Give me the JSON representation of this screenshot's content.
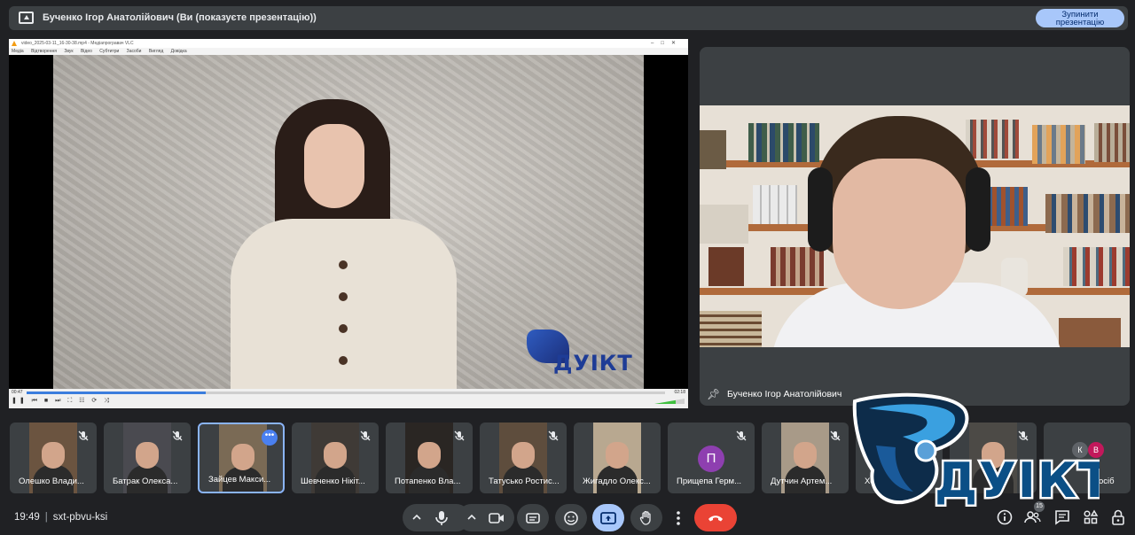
{
  "presenting_bar": {
    "text": "Бученко Ігор Анатолійович (Ви (показуєте презентацію))",
    "stop_button_line1": "Зупинити",
    "stop_button_line2": "презентацію"
  },
  "shared_window": {
    "title": "video_2025-03-11_16-30-38.mp4 - Медіапрогравач VLC",
    "menu": [
      "Медіа",
      "Відтворення",
      "Звук",
      "Відео",
      "Субтитри",
      "Засоби",
      "Вигляд",
      "Довідка"
    ],
    "time_elapsed": "00:47",
    "time_total": "02:18",
    "progress": 0.28,
    "watermark_text": "ДУІКТ"
  },
  "main_speaker": {
    "name": "Бученко Ігор Анатолійович"
  },
  "participants": [
    {
      "name": "Олешко Влади...",
      "muted": true,
      "active": false
    },
    {
      "name": "Батрак Олекса...",
      "muted": true,
      "active": false
    },
    {
      "name": "Зайцев Макси...",
      "muted": false,
      "active": true
    },
    {
      "name": "Шевченко Нікіт...",
      "muted": true,
      "active": false
    },
    {
      "name": "Потапенко Вла...",
      "muted": true,
      "active": false
    },
    {
      "name": "Татусько Ростис...",
      "muted": true,
      "active": false
    },
    {
      "name": "Жигадло Олекс...",
      "muted": false,
      "active": false
    },
    {
      "name": "Прищепа Герм...",
      "muted": true,
      "active": false,
      "avatar_letter": "П"
    },
    {
      "name": "Дутчин Артем...",
      "muted": true,
      "active": false
    },
    {
      "name": "Хот...",
      "muted": true,
      "active": false
    },
    {
      "name": "",
      "muted": true,
      "active": false
    }
  ],
  "others_tile": {
    "avatar_letters": [
      "К",
      "В"
    ],
    "label": "осіб"
  },
  "overlay_logo_text": "ДУІКТ",
  "bottom_bar": {
    "time": "19:49",
    "meeting_code": "sxt-pbvu-ksi"
  },
  "colors": {
    "background": "#202124",
    "surface": "#3c4043",
    "accent": "#a8c7fa",
    "end_call": "#ea4335",
    "active_tile_border": "#8ab4f8",
    "logo_blue": "#1e3c96"
  },
  "icons": {
    "present": "present-to-all-icon",
    "mic": "microphone-icon",
    "camera": "camera-icon",
    "captions": "captions-icon",
    "emoji": "emoji-icon",
    "share": "present-screen-icon",
    "raise_hand": "raise-hand-icon",
    "more": "more-vert-icon",
    "end_call": "call-end-icon",
    "info": "info-icon",
    "people": "people-icon",
    "chat": "chat-icon",
    "activities": "activities-icon",
    "lock": "host-controls-icon"
  }
}
